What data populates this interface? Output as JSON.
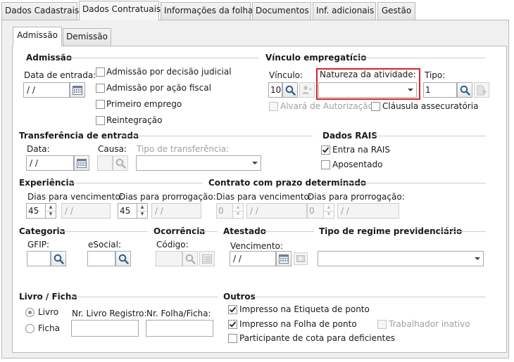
{
  "tabs": [
    "Dados Cadastrais",
    "Dados Contratuais",
    "Informações da folha",
    "Documentos",
    "Inf. adicionais",
    "Gestão"
  ],
  "subtabs": [
    "Admissão",
    "Demissão"
  ],
  "admissao": {
    "title": "Admissão",
    "data_entrada_label": "Data de entrada:",
    "data_entrada_value": "/ /",
    "checks": [
      "Admissão por decisão judicial",
      "Admissão por ação fiscal",
      "Primeiro emprego",
      "Reintegração"
    ]
  },
  "vinculo": {
    "title": "Vínculo empregatício",
    "vinculo_label": "Vínculo:",
    "vinculo_value": "10",
    "natureza_label": "Natureza da atividade:",
    "natureza_value": "",
    "tipo_label": "Tipo:",
    "tipo_value": "1",
    "alvara_label": "Alvará de Autorização",
    "clausula_label": "Cláusula assecuratória"
  },
  "transferencia": {
    "title": "Transferência de entrada",
    "data_label": "Data:",
    "data_value": "/ /",
    "causa_label": "Causa:",
    "tipo_label": "Tipo de transferência:"
  },
  "rais": {
    "title": "Dados RAIS",
    "entra_label": "Entra na RAIS",
    "entra_checked": true,
    "aposentado_label": "Aposentado"
  },
  "experiencia": {
    "title": "Experiência",
    "venc_label": "Dias para vencimento:",
    "venc_value": "45",
    "venc_date": "/ /",
    "prorr_label": "Dias para prorrogação:",
    "prorr_value": "45",
    "prorr_date": "/ /"
  },
  "contrato": {
    "title": "Contrato com prazo determinado",
    "venc_label": "Dias para vencimento:",
    "venc_value": "0",
    "venc_date": "/ /",
    "prorr_label": "Dias para prorrogação:",
    "prorr_value": "0",
    "prorr_date": "/ /"
  },
  "categoria": {
    "title": "Categoria",
    "gfip_label": "GFIP:",
    "esocial_label": "eSocial:"
  },
  "ocorrencia": {
    "title": "Ocorrência",
    "codigo_label": "Código:"
  },
  "atestado": {
    "title": "Atestado",
    "venc_label": "Vencimento:",
    "venc_value": "/ /"
  },
  "regime": {
    "title": "Tipo de regime previdenciário",
    "value": ""
  },
  "livro": {
    "title": "Livro / Ficha",
    "livro_label": "Livro",
    "ficha_label": "Ficha",
    "selected": "Livro",
    "nr_livro_label": "Nr. Livro Registro:",
    "nr_folha_label": "Nr. Folha/Ficha:"
  },
  "outros": {
    "title": "Outros",
    "etiqueta_label": "Impresso na Etiqueta de ponto",
    "folha_label": "Impresso na Folha de ponto",
    "inativo_label": "Trabalhador inativo",
    "cota_label": "Participante de cota para deficientes"
  }
}
